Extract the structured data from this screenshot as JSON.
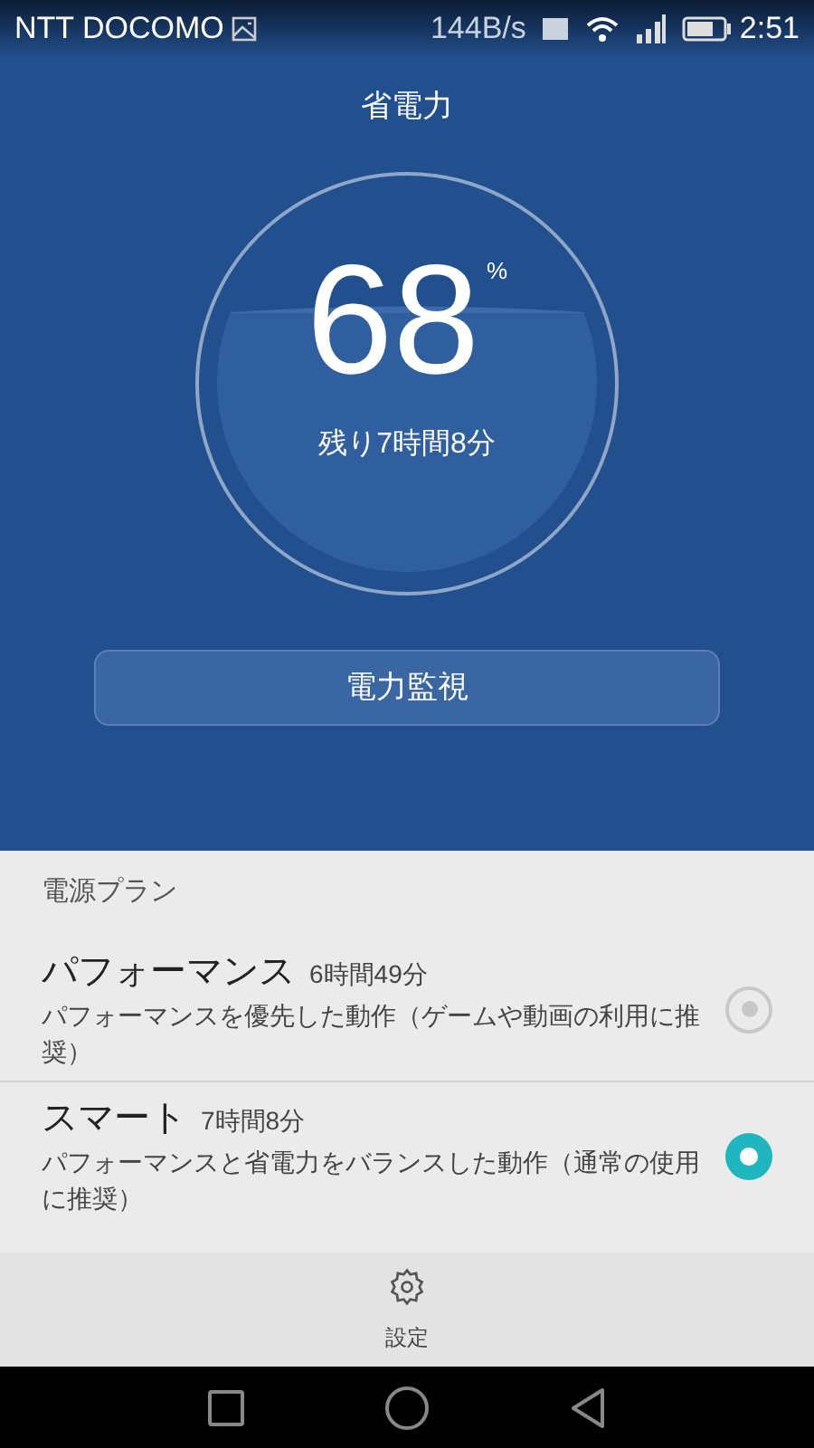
{
  "status_bar": {
    "carrier": "NTT DOCOMO",
    "speed": "144B/s",
    "time": "2:51"
  },
  "title": "省電力",
  "battery": {
    "percent": "68",
    "unit": "%",
    "remaining": "残り7時間8分"
  },
  "monitor_button": "電力監視",
  "section_label": "電源プラン",
  "plans": [
    {
      "name": "パフォーマンス",
      "time": "6時間49分",
      "description": "パフォーマンスを優先した動作（ゲームや動画の利用に推奨）",
      "selected": false
    },
    {
      "name": "スマート",
      "time": "7時間8分",
      "description": "パフォーマンスと省電力をバランスした動作（通常の使用に推奨）",
      "selected": true
    }
  ],
  "bottom_action": "設定"
}
